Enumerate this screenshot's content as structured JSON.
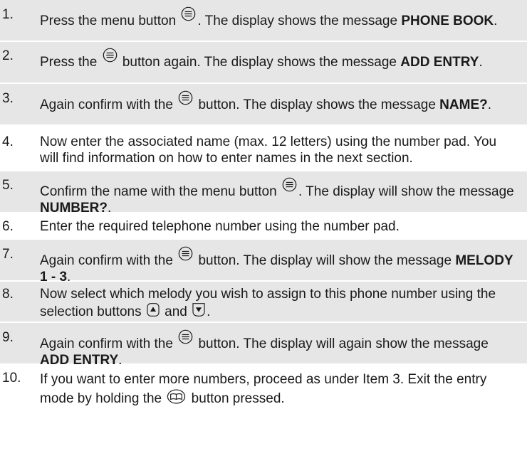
{
  "steps": [
    {
      "number": "1.",
      "t1": "Press the menu button ",
      "t2": ". The display shows the message ",
      "bold": "PHONE BOOK",
      "t3": ".",
      "icon": "menu-button-icon"
    },
    {
      "number": "2.",
      "t1": "Press the ",
      "t2": " button again. The display shows the message ",
      "bold": "ADD ENTRY",
      "t3": ".",
      "icon": "menu-button-icon"
    },
    {
      "number": "3.",
      "t1": "Again confirm with the ",
      "t2": " button. The display shows the message ",
      "bold": "NAME?",
      "t3": ".",
      "icon": "menu-button-icon"
    },
    {
      "number": "4.",
      "text": "Now enter the associated name (max. 12 letters) using the number pad. You will find information on how to enter names in the next section."
    },
    {
      "number": "5.",
      "t1": "Confirm the name with the menu button ",
      "t2": ". The display will show the message ",
      "bold": "NUMBER?",
      "t3": ".",
      "icon": "menu-button-icon"
    },
    {
      "number": "6.",
      "text": "Enter the required telephone number using the number pad."
    },
    {
      "number": "7.",
      "t1": "Again confirm with the ",
      "t2": " button. The display will show the message ",
      "bold": "MELODY 1 - 3",
      "t3": ".",
      "icon": "menu-button-icon"
    },
    {
      "number": "8.",
      "t1": "Now select which melody you wish to assign to this phone number using the selection buttons ",
      "t2": " and ",
      "t3": ".",
      "icon_up": "up-arrow-button-icon",
      "icon_down": "down-arrow-button-icon"
    },
    {
      "number": "9.",
      "t1": "Again confirm with the ",
      "t2": " button. The display will again show the message ",
      "bold": "ADD ENTRY",
      "t3": ".",
      "icon": "menu-button-icon"
    },
    {
      "number": "10.",
      "t1": "If you want to enter more numbers, proceed as under Item 3. Exit the entry mode by holding the ",
      "t2": " button pressed.",
      "icon": "phonebook-button-icon"
    }
  ],
  "colors": {
    "row_shading": "#e6e6e6",
    "text": "#1a1a1a"
  }
}
